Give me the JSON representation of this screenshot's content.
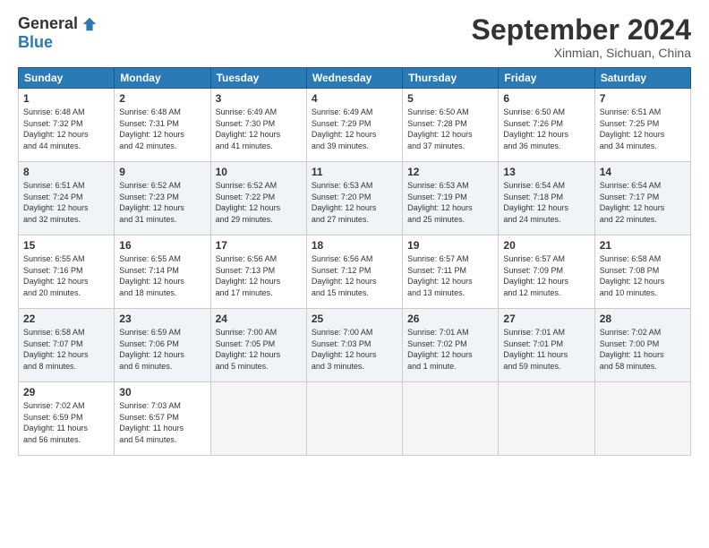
{
  "logo": {
    "general": "General",
    "blue": "Blue"
  },
  "title": "September 2024",
  "subtitle": "Xinmian, Sichuan, China",
  "days_header": [
    "Sunday",
    "Monday",
    "Tuesday",
    "Wednesday",
    "Thursday",
    "Friday",
    "Saturday"
  ],
  "weeks": [
    [
      {
        "num": "1",
        "info": "Sunrise: 6:48 AM\nSunset: 7:32 PM\nDaylight: 12 hours\nand 44 minutes."
      },
      {
        "num": "2",
        "info": "Sunrise: 6:48 AM\nSunset: 7:31 PM\nDaylight: 12 hours\nand 42 minutes."
      },
      {
        "num": "3",
        "info": "Sunrise: 6:49 AM\nSunset: 7:30 PM\nDaylight: 12 hours\nand 41 minutes."
      },
      {
        "num": "4",
        "info": "Sunrise: 6:49 AM\nSunset: 7:29 PM\nDaylight: 12 hours\nand 39 minutes."
      },
      {
        "num": "5",
        "info": "Sunrise: 6:50 AM\nSunset: 7:28 PM\nDaylight: 12 hours\nand 37 minutes."
      },
      {
        "num": "6",
        "info": "Sunrise: 6:50 AM\nSunset: 7:26 PM\nDaylight: 12 hours\nand 36 minutes."
      },
      {
        "num": "7",
        "info": "Sunrise: 6:51 AM\nSunset: 7:25 PM\nDaylight: 12 hours\nand 34 minutes."
      }
    ],
    [
      {
        "num": "8",
        "info": "Sunrise: 6:51 AM\nSunset: 7:24 PM\nDaylight: 12 hours\nand 32 minutes."
      },
      {
        "num": "9",
        "info": "Sunrise: 6:52 AM\nSunset: 7:23 PM\nDaylight: 12 hours\nand 31 minutes."
      },
      {
        "num": "10",
        "info": "Sunrise: 6:52 AM\nSunset: 7:22 PM\nDaylight: 12 hours\nand 29 minutes."
      },
      {
        "num": "11",
        "info": "Sunrise: 6:53 AM\nSunset: 7:20 PM\nDaylight: 12 hours\nand 27 minutes."
      },
      {
        "num": "12",
        "info": "Sunrise: 6:53 AM\nSunset: 7:19 PM\nDaylight: 12 hours\nand 25 minutes."
      },
      {
        "num": "13",
        "info": "Sunrise: 6:54 AM\nSunset: 7:18 PM\nDaylight: 12 hours\nand 24 minutes."
      },
      {
        "num": "14",
        "info": "Sunrise: 6:54 AM\nSunset: 7:17 PM\nDaylight: 12 hours\nand 22 minutes."
      }
    ],
    [
      {
        "num": "15",
        "info": "Sunrise: 6:55 AM\nSunset: 7:16 PM\nDaylight: 12 hours\nand 20 minutes."
      },
      {
        "num": "16",
        "info": "Sunrise: 6:55 AM\nSunset: 7:14 PM\nDaylight: 12 hours\nand 18 minutes."
      },
      {
        "num": "17",
        "info": "Sunrise: 6:56 AM\nSunset: 7:13 PM\nDaylight: 12 hours\nand 17 minutes."
      },
      {
        "num": "18",
        "info": "Sunrise: 6:56 AM\nSunset: 7:12 PM\nDaylight: 12 hours\nand 15 minutes."
      },
      {
        "num": "19",
        "info": "Sunrise: 6:57 AM\nSunset: 7:11 PM\nDaylight: 12 hours\nand 13 minutes."
      },
      {
        "num": "20",
        "info": "Sunrise: 6:57 AM\nSunset: 7:09 PM\nDaylight: 12 hours\nand 12 minutes."
      },
      {
        "num": "21",
        "info": "Sunrise: 6:58 AM\nSunset: 7:08 PM\nDaylight: 12 hours\nand 10 minutes."
      }
    ],
    [
      {
        "num": "22",
        "info": "Sunrise: 6:58 AM\nSunset: 7:07 PM\nDaylight: 12 hours\nand 8 minutes."
      },
      {
        "num": "23",
        "info": "Sunrise: 6:59 AM\nSunset: 7:06 PM\nDaylight: 12 hours\nand 6 minutes."
      },
      {
        "num": "24",
        "info": "Sunrise: 7:00 AM\nSunset: 7:05 PM\nDaylight: 12 hours\nand 5 minutes."
      },
      {
        "num": "25",
        "info": "Sunrise: 7:00 AM\nSunset: 7:03 PM\nDaylight: 12 hours\nand 3 minutes."
      },
      {
        "num": "26",
        "info": "Sunrise: 7:01 AM\nSunset: 7:02 PM\nDaylight: 12 hours\nand 1 minute."
      },
      {
        "num": "27",
        "info": "Sunrise: 7:01 AM\nSunset: 7:01 PM\nDaylight: 11 hours\nand 59 minutes."
      },
      {
        "num": "28",
        "info": "Sunrise: 7:02 AM\nSunset: 7:00 PM\nDaylight: 11 hours\nand 58 minutes."
      }
    ],
    [
      {
        "num": "29",
        "info": "Sunrise: 7:02 AM\nSunset: 6:59 PM\nDaylight: 11 hours\nand 56 minutes."
      },
      {
        "num": "30",
        "info": "Sunrise: 7:03 AM\nSunset: 6:57 PM\nDaylight: 11 hours\nand 54 minutes."
      },
      {
        "num": "",
        "info": ""
      },
      {
        "num": "",
        "info": ""
      },
      {
        "num": "",
        "info": ""
      },
      {
        "num": "",
        "info": ""
      },
      {
        "num": "",
        "info": ""
      }
    ]
  ]
}
